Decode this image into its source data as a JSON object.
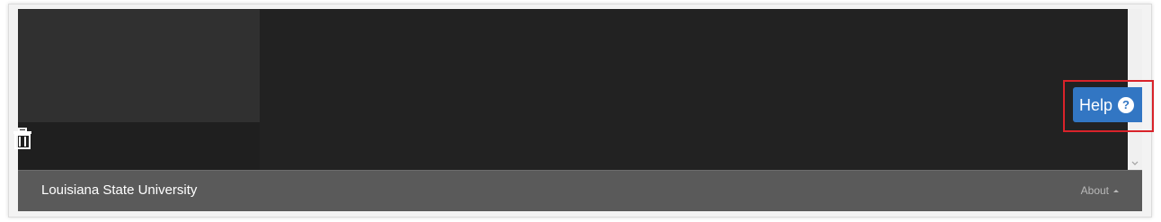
{
  "help": {
    "label": "Help",
    "icon": "question-circle-icon",
    "icon_glyph": "?",
    "highlight_color": "#d9232a",
    "background_color": "#3276c3"
  },
  "left_panel": {
    "action_icon": "trash-icon"
  },
  "footer": {
    "title": "Louisiana State University",
    "about_label": "About",
    "about_icon": "caret-up-icon"
  },
  "colors": {
    "app_background": "#222222",
    "footer_background": "#5a5a5a"
  }
}
